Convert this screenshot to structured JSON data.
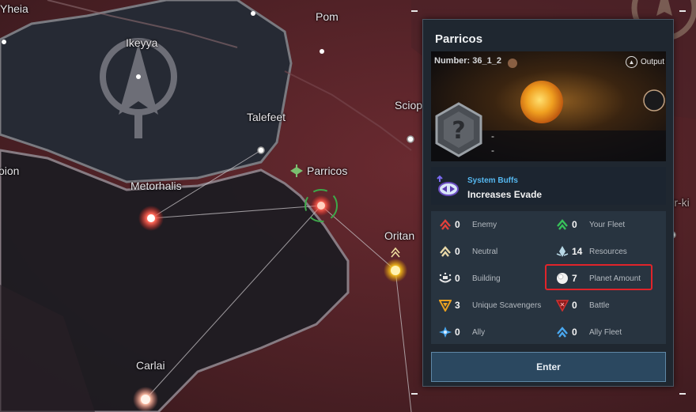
{
  "map": {
    "systems": [
      {
        "name": "Yheia"
      },
      {
        "name": "Pom"
      },
      {
        "name": "Ikeyya"
      },
      {
        "name": "Talefeet"
      },
      {
        "name": "Sciope"
      },
      {
        "name": "Parricos"
      },
      {
        "name": "Metorhalis"
      },
      {
        "name": "oion"
      },
      {
        "name": "Oritan"
      },
      {
        "name": "Carlai"
      },
      {
        "name": "Sr-ki"
      }
    ]
  },
  "panel": {
    "title": "Parricos",
    "number_label": "Number: 36_1_2",
    "output_label": "Output",
    "unknown_line1": "-",
    "unknown_line2": "-",
    "buff_title": "System Buffs",
    "buff_value": "Increases Evade",
    "stats": [
      {
        "value": "0",
        "label": "Enemy",
        "icon": "enemy-chevron-icon",
        "color": "#e2403a"
      },
      {
        "value": "0",
        "label": "Your Fleet",
        "icon": "fleet-chevron-icon",
        "color": "#38c25a"
      },
      {
        "value": "0",
        "label": "Neutral",
        "icon": "neutral-chevron-icon",
        "color": "#e8d8a8"
      },
      {
        "value": "14",
        "label": "Resources",
        "icon": "resources-icon",
        "color": "#b8d8e6"
      },
      {
        "value": "0",
        "label": "Building",
        "icon": "building-icon",
        "color": "#e6e6e6"
      },
      {
        "value": "7",
        "label": "Planet Amount",
        "icon": "planet-icon",
        "color": "#f0f0f0"
      },
      {
        "value": "3",
        "label": "Unique Scavengers",
        "icon": "scavenger-icon",
        "color": "#e9a020"
      },
      {
        "value": "0",
        "label": "Battle",
        "icon": "battle-icon",
        "color": "#d03030"
      },
      {
        "value": "0",
        "label": "Ally",
        "icon": "ally-icon",
        "color": "#4aa8f0"
      },
      {
        "value": "0",
        "label": "Ally Fleet",
        "icon": "ally-fleet-icon",
        "color": "#4aa8f0"
      }
    ],
    "enter_label": "Enter"
  }
}
